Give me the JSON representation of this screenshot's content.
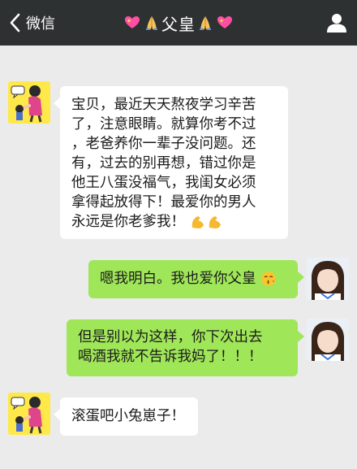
{
  "nav": {
    "back_label": "微信",
    "title": "父皇"
  },
  "messages": [
    {
      "sender": "dad",
      "direction": "in",
      "lines": [
        "宝贝，最近天天熬夜学习辛苦",
        "了，注意眼睛。就算你考不过",
        "，老爸养你一辈子没问题。还",
        "有，过去的别再想，错过你是",
        "他王八蛋没福气，我闺女必须",
        "拿得起放得下！最爱你的男人",
        "永远是你老爹我！"
      ],
      "trailing_emoji": "flexed-biceps-icon x2"
    },
    {
      "sender": "me",
      "direction": "out",
      "lines": [
        "嗯我明白。我也爱你父皇"
      ],
      "trailing_emoji": "kissing-face-icon"
    },
    {
      "sender": "me",
      "direction": "out",
      "lines": [
        "但是别以为这样，你下次出去",
        "喝酒我就不告诉我妈了！！！"
      ]
    },
    {
      "sender": "dad",
      "direction": "in",
      "lines": [
        "滚蛋吧小兔崽子！"
      ]
    }
  ],
  "colors": {
    "topbar": "#2e3132",
    "background": "#ebebeb",
    "incoming_bubble": "#ffffff",
    "outgoing_bubble": "#9fe658"
  }
}
